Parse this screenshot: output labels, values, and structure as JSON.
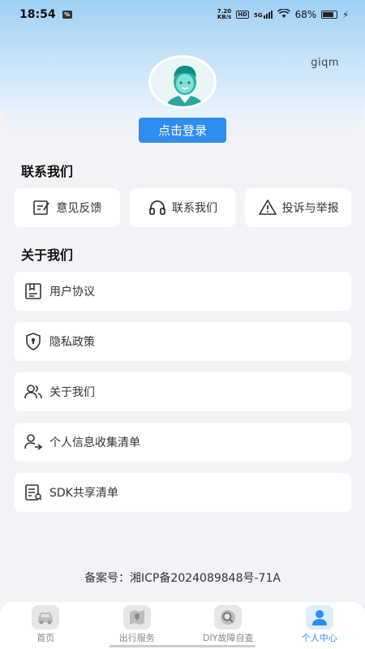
{
  "status_bar": {
    "time": "18:54",
    "net_speed_value": "7.20",
    "net_speed_unit": "KB/s",
    "hd_label": "HD",
    "signal_label": "5G",
    "battery_text": "68%",
    "battery_level": 0.68
  },
  "header": {
    "username": "giqm",
    "login_label": "点击登录"
  },
  "contact_section": {
    "title": "联系我们",
    "items": [
      {
        "label": "意见反馈",
        "icon": "feedback-icon"
      },
      {
        "label": "联系我们",
        "icon": "headset-icon"
      },
      {
        "label": "投诉与举报",
        "icon": "warning-icon"
      }
    ]
  },
  "about_section": {
    "title": "关于我们",
    "items": [
      {
        "label": "用户协议",
        "icon": "agreement-icon"
      },
      {
        "label": "隐私政策",
        "icon": "shield-icon"
      },
      {
        "label": "关于我们",
        "icon": "users-icon"
      },
      {
        "label": "个人信息收集清单",
        "icon": "user-list-icon"
      },
      {
        "label": "SDK共享清单",
        "icon": "document-list-icon"
      }
    ]
  },
  "footer": {
    "record_number": "备案号：湘ICP备2024089848号-71A"
  },
  "tabbar": {
    "tabs": [
      {
        "label": "首页",
        "icon": "car-icon",
        "active": false
      },
      {
        "label": "出行服务",
        "icon": "map-icon",
        "active": false
      },
      {
        "label": "DIY故障自查",
        "icon": "diagnose-icon",
        "active": false
      },
      {
        "label": "个人中心",
        "icon": "person-icon",
        "active": true
      }
    ]
  },
  "colors": {
    "accent": "#2f8cf0",
    "background": "#f1f3f6"
  }
}
